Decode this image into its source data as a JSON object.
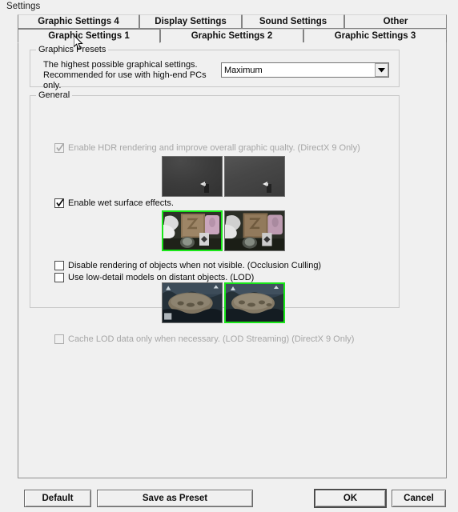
{
  "window": {
    "title": "Settings"
  },
  "tabs": {
    "row_top": [
      {
        "label": "Graphic Settings 4",
        "selected": false
      },
      {
        "label": "Display Settings",
        "selected": false
      },
      {
        "label": "Sound Settings",
        "selected": false
      },
      {
        "label": "Other",
        "selected": false
      }
    ],
    "row_bottom": [
      {
        "label": "Graphic Settings 1",
        "selected": true
      },
      {
        "label": "Graphic Settings 2",
        "selected": false
      },
      {
        "label": "Graphic Settings 3",
        "selected": false
      }
    ]
  },
  "presets": {
    "group_label": "Graphics Presets",
    "description": "The highest possible graphical settings. Recommended for use with high-end PCs only.",
    "selected_value": "Maximum"
  },
  "general": {
    "group_label": "General",
    "options": [
      {
        "label": "Enable HDR rendering and improve overall graphic qualty.  (DirectX 9 Only)",
        "checked": true,
        "enabled": false
      },
      {
        "label": "Enable wet surface effects.",
        "checked": true,
        "enabled": true
      },
      {
        "label": "Disable rendering of objects when not visible.  (Occlusion Culling)",
        "checked": false,
        "enabled": true
      },
      {
        "label": "Use low-detail models on distant objects. (LOD)",
        "checked": false,
        "enabled": true
      },
      {
        "label": "Cache LOD data only when necessary. (LOD Streaming) (DirectX 9 Only)",
        "checked": false,
        "enabled": false
      }
    ],
    "previews": {
      "hdr": {
        "left_selected": false,
        "right_selected": false
      },
      "wet": {
        "left_selected": true,
        "right_selected": false
      },
      "lod": {
        "left_selected": false,
        "right_selected": true
      }
    }
  },
  "footer": {
    "default_label": "Default",
    "save_preset_label": "Save as Preset",
    "ok_label": "OK",
    "cancel_label": "Cancel"
  },
  "colors": {
    "selection_green": "#19e619",
    "window_bg": "#f0f0f0",
    "border": "#919191",
    "disabled_text": "#a6a6a6"
  }
}
